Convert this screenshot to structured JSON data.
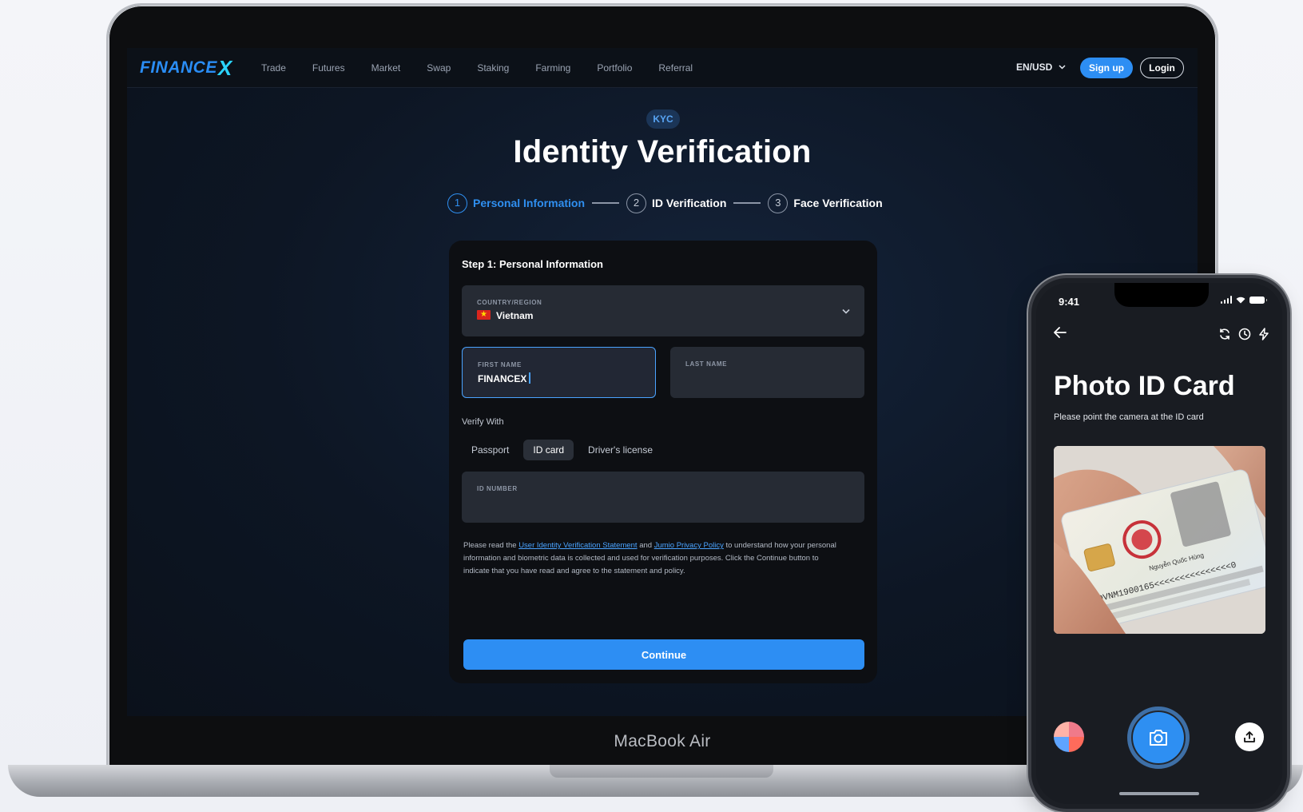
{
  "laptop": {
    "brand": "MacBook Air",
    "nav": {
      "logo": "FINANCE",
      "logo_x": "X",
      "links": [
        "Trade",
        "Futures",
        "Market",
        "Swap",
        "Staking",
        "Farming",
        "Portfolio",
        "Referral"
      ],
      "language": "EN/USD",
      "signup": "Sign up",
      "login": "Login"
    },
    "badge": "KYC",
    "title": "Identity Verification",
    "steps": [
      {
        "num": "1",
        "label": "Personal Information",
        "active": true
      },
      {
        "num": "2",
        "label": "ID Verification",
        "active": false
      },
      {
        "num": "3",
        "label": "Face Verification",
        "active": false
      }
    ],
    "form": {
      "title": "Step 1: Personal Information",
      "country_label": "COUNTRY/REGION",
      "country_value": "Vietnam",
      "first_name_label": "FIRST NAME",
      "first_name_value": "FINANCEX",
      "last_name_label": "LAST NAME",
      "last_name_value": "",
      "verify_with_label": "Verify With",
      "verify_options": [
        "Passport",
        "ID card",
        "Driver's license"
      ],
      "verify_selected": "ID card",
      "id_number_label": "ID NUMBER",
      "id_number_value": "",
      "legal_prefix": "Please read the ",
      "legal_link1": "User Identity Verification Statement",
      "legal_mid": " and ",
      "legal_link2": "Jumio Privacy Policy",
      "legal_suffix": " to understand how your personal information and biometric data is collected and used for verification purposes. Click the Continue button to indicate that you have read and agree to the statement and policy.",
      "continue": "Continue"
    }
  },
  "phone": {
    "time": "9:41",
    "title": "Photo ID Card",
    "subtitle": "Please point the camera at the ID card",
    "card_name": "Nguyễn Quốc Hùng",
    "card_mrz": "IDVNM1900165<<<<<<<<<<<<<<<0"
  },
  "colors": {
    "accent": "#2d8ef3",
    "screen_bg": "#0d1624",
    "card_bg": "#0d0f13",
    "field_bg": "#262b34"
  }
}
